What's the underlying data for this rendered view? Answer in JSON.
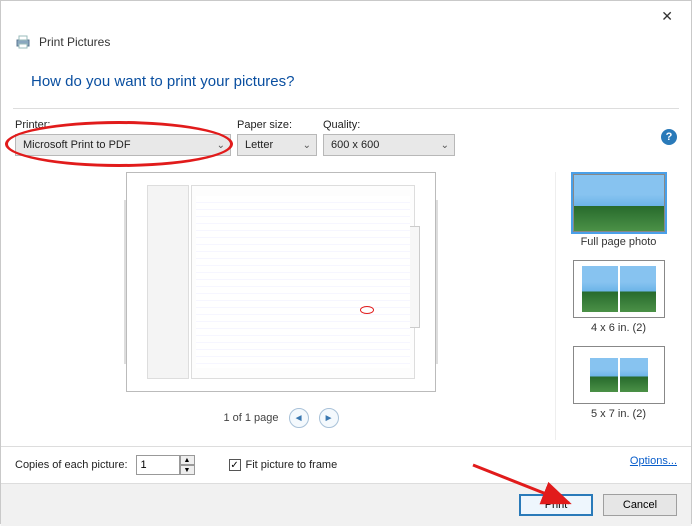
{
  "window": {
    "title": "Print Pictures"
  },
  "heading": "How do you want to print your pictures?",
  "labels": {
    "printer": "Printer:",
    "paper": "Paper size:",
    "quality": "Quality:",
    "copies": "Copies of each picture:",
    "fit": "Fit picture to frame",
    "options": "Options..."
  },
  "values": {
    "printer": "Microsoft Print to PDF",
    "paper": "Letter",
    "quality": "600 x 600",
    "copies": "1",
    "fit_checked": "✓"
  },
  "pager": {
    "text": "1 of 1 page"
  },
  "layouts": [
    {
      "label": "Full page photo"
    },
    {
      "label": "4 x 6 in. (2)"
    },
    {
      "label": "5 x 7 in. (2)"
    }
  ],
  "buttons": {
    "print": "Print",
    "cancel": "Cancel"
  },
  "help": "?"
}
